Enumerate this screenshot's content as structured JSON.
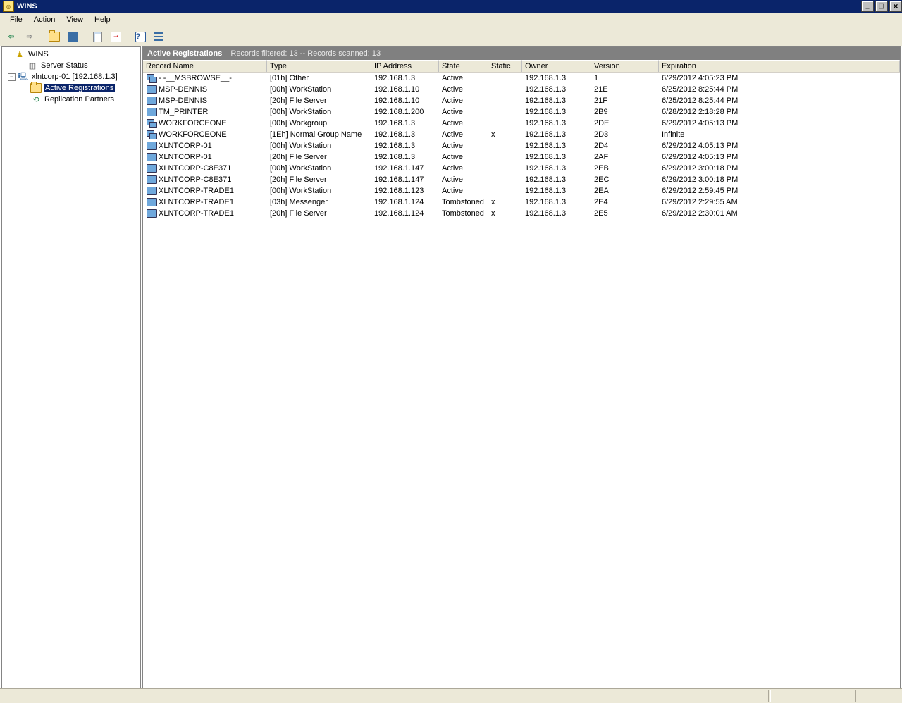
{
  "window": {
    "title": "WINS"
  },
  "menu": {
    "file": "File",
    "action": "Action",
    "view": "View",
    "help": "Help"
  },
  "tree": {
    "root": "WINS",
    "server_status": "Server Status",
    "host": "xlntcorp-01 [192.168.1.3]",
    "active_registrations": "Active Registrations",
    "replication_partners": "Replication Partners"
  },
  "band": {
    "title": "Active Registrations",
    "status": "Records filtered: 13 -- Records scanned: 13"
  },
  "columns": {
    "name": "Record Name",
    "type": "Type",
    "ip": "IP Address",
    "state": "State",
    "static": "Static",
    "owner": "Owner",
    "version": "Version",
    "expiration": "Expiration"
  },
  "records": [
    {
      "icon": "group",
      "name": "- -__MSBROWSE__-",
      "type": "[01h] Other",
      "ip": "192.168.1.3",
      "state": "Active",
      "static": "",
      "owner": "192.168.1.3",
      "version": "1",
      "expiration": "6/29/2012 4:05:23 PM"
    },
    {
      "icon": "ws",
      "name": "MSP-DENNIS",
      "type": "[00h] WorkStation",
      "ip": "192.168.1.10",
      "state": "Active",
      "static": "",
      "owner": "192.168.1.3",
      "version": "21E",
      "expiration": "6/25/2012 8:25:44 PM"
    },
    {
      "icon": "ws",
      "name": "MSP-DENNIS",
      "type": "[20h] File Server",
      "ip": "192.168.1.10",
      "state": "Active",
      "static": "",
      "owner": "192.168.1.3",
      "version": "21F",
      "expiration": "6/25/2012 8:25:44 PM"
    },
    {
      "icon": "ws",
      "name": "TM_PRINTER",
      "type": "[00h] WorkStation",
      "ip": "192.168.1.200",
      "state": "Active",
      "static": "",
      "owner": "192.168.1.3",
      "version": "2B9",
      "expiration": "6/28/2012 2:18:28 PM"
    },
    {
      "icon": "group",
      "name": "WORKFORCEONE",
      "type": "[00h] Workgroup",
      "ip": "192.168.1.3",
      "state": "Active",
      "static": "",
      "owner": "192.168.1.3",
      "version": "2DE",
      "expiration": "6/29/2012 4:05:13 PM"
    },
    {
      "icon": "group",
      "name": "WORKFORCEONE",
      "type": "[1Eh] Normal Group Name",
      "ip": "192.168.1.3",
      "state": "Active",
      "static": "x",
      "owner": "192.168.1.3",
      "version": "2D3",
      "expiration": "Infinite"
    },
    {
      "icon": "ws",
      "name": "XLNTCORP-01",
      "type": "[00h] WorkStation",
      "ip": "192.168.1.3",
      "state": "Active",
      "static": "",
      "owner": "192.168.1.3",
      "version": "2D4",
      "expiration": "6/29/2012 4:05:13 PM"
    },
    {
      "icon": "ws",
      "name": "XLNTCORP-01",
      "type": "[20h] File Server",
      "ip": "192.168.1.3",
      "state": "Active",
      "static": "",
      "owner": "192.168.1.3",
      "version": "2AF",
      "expiration": "6/29/2012 4:05:13 PM"
    },
    {
      "icon": "ws",
      "name": "XLNTCORP-C8E371",
      "type": "[00h] WorkStation",
      "ip": "192.168.1.147",
      "state": "Active",
      "static": "",
      "owner": "192.168.1.3",
      "version": "2EB",
      "expiration": "6/29/2012 3:00:18 PM"
    },
    {
      "icon": "ws",
      "name": "XLNTCORP-C8E371",
      "type": "[20h] File Server",
      "ip": "192.168.1.147",
      "state": "Active",
      "static": "",
      "owner": "192.168.1.3",
      "version": "2EC",
      "expiration": "6/29/2012 3:00:18 PM"
    },
    {
      "icon": "ws",
      "name": "XLNTCORP-TRADE1",
      "type": "[00h] WorkStation",
      "ip": "192.168.1.123",
      "state": "Active",
      "static": "",
      "owner": "192.168.1.3",
      "version": "2EA",
      "expiration": "6/29/2012 2:59:45 PM"
    },
    {
      "icon": "ws",
      "name": "XLNTCORP-TRADE1",
      "type": "[03h] Messenger",
      "ip": "192.168.1.124",
      "state": "Tombstoned",
      "static": "x",
      "owner": "192.168.1.3",
      "version": "2E4",
      "expiration": "6/29/2012 2:29:55 AM"
    },
    {
      "icon": "ws",
      "name": "XLNTCORP-TRADE1",
      "type": "[20h] File Server",
      "ip": "192.168.1.124",
      "state": "Tombstoned",
      "static": "x",
      "owner": "192.168.1.3",
      "version": "2E5",
      "expiration": "6/29/2012 2:30:01 AM"
    }
  ]
}
